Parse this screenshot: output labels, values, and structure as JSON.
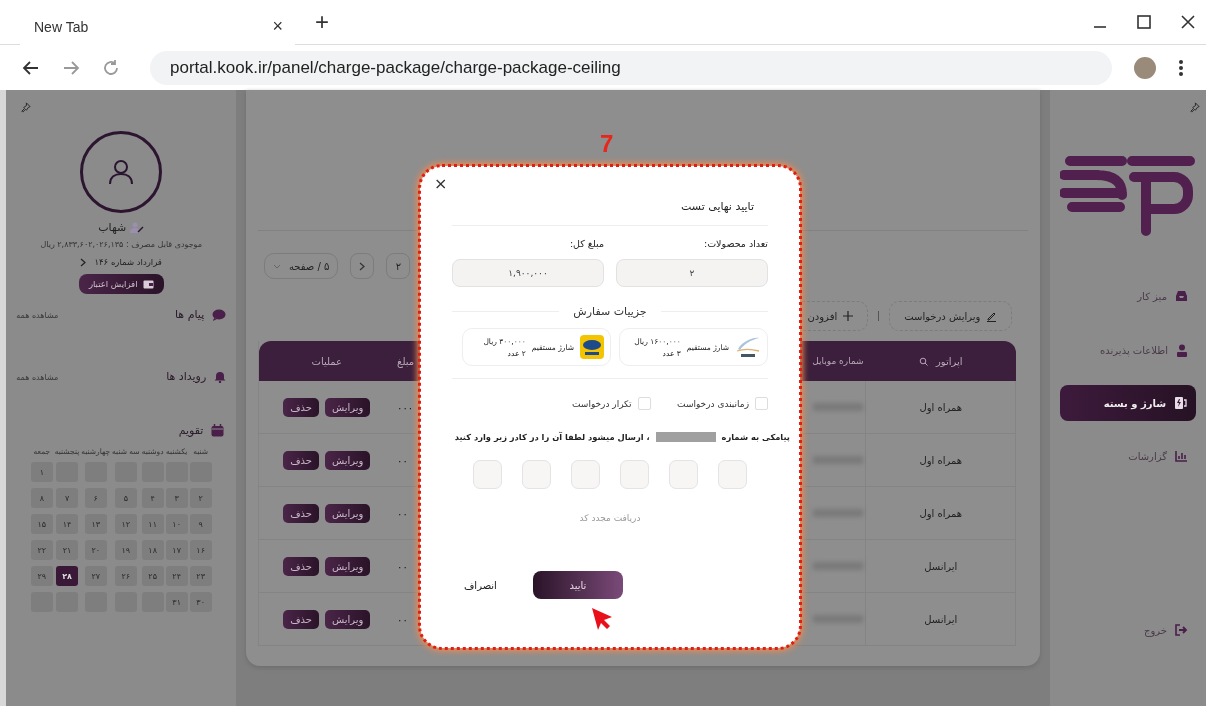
{
  "browser": {
    "tab_title": "New Tab",
    "tab_close": "×",
    "new_tab": "+",
    "url": "portal.kook.ir/panel/charge-package/charge-package-ceiling"
  },
  "left_panel": {
    "user_name": "شهاب",
    "balance": "موجودی قابل مصرف : ۲,۸۳۳,۶۰۲,۰۲۶,۱۳۵ ریال",
    "contract": "قرارداد شماره ۱۴۶",
    "credit_button": "افزایش اعتبار",
    "sections": [
      {
        "kind": "messages",
        "title": "پیام ها",
        "link": "مشاهده همه"
      },
      {
        "kind": "events",
        "title": "رویداد ها",
        "link": "مشاهده همه"
      }
    ],
    "calendar": {
      "title": "تقویم",
      "weekdays": [
        "شنبه",
        "یکشنبه",
        "دوشنبه",
        "سه شنبه",
        "چهارشنبه",
        "پنجشنبه",
        "جمعه"
      ],
      "cells": [
        {
          "kind": "blank"
        },
        {
          "kind": "blank"
        },
        {
          "kind": "blank"
        },
        {
          "kind": "blank"
        },
        {
          "kind": "blank"
        },
        {
          "kind": "blank"
        },
        {
          "kind": "day",
          "day": "۱",
          "selected": false
        },
        {
          "kind": "day",
          "day": "۲",
          "selected": false
        },
        {
          "kind": "day",
          "day": "۳",
          "selected": false
        },
        {
          "kind": "day",
          "day": "۴",
          "selected": false
        },
        {
          "kind": "day",
          "day": "۵",
          "selected": false
        },
        {
          "kind": "day",
          "day": "۶",
          "selected": false
        },
        {
          "kind": "day",
          "day": "۷",
          "selected": false
        },
        {
          "kind": "day",
          "day": "۸",
          "selected": false
        },
        {
          "kind": "day",
          "day": "۹",
          "selected": false
        },
        {
          "kind": "day",
          "day": "۱۰",
          "selected": false
        },
        {
          "kind": "day",
          "day": "۱۱",
          "selected": false
        },
        {
          "kind": "day",
          "day": "۱۲",
          "selected": false
        },
        {
          "kind": "day",
          "day": "۱۳",
          "selected": false
        },
        {
          "kind": "day",
          "day": "۱۴",
          "selected": false
        },
        {
          "kind": "day",
          "day": "۱۵",
          "selected": false
        },
        {
          "kind": "day",
          "day": "۱۶",
          "selected": false
        },
        {
          "kind": "day",
          "day": "۱۷",
          "selected": false
        },
        {
          "kind": "day",
          "day": "۱۸",
          "selected": false
        },
        {
          "kind": "day",
          "day": "۱۹",
          "selected": false
        },
        {
          "kind": "day",
          "day": "۲۰",
          "selected": false
        },
        {
          "kind": "day",
          "day": "۲۱",
          "selected": false
        },
        {
          "kind": "day",
          "day": "۲۲",
          "selected": false
        },
        {
          "kind": "day",
          "day": "۲۳",
          "selected": false
        },
        {
          "kind": "day",
          "day": "۲۴",
          "selected": false
        },
        {
          "kind": "day",
          "day": "۲۵",
          "selected": false
        },
        {
          "kind": "day",
          "day": "۲۶",
          "selected": false
        },
        {
          "kind": "day",
          "day": "۲۷",
          "selected": false
        },
        {
          "kind": "day",
          "day": "۲۸",
          "selected": true
        },
        {
          "kind": "day",
          "day": "۲۹",
          "selected": false
        },
        {
          "kind": "day",
          "day": "۳۰",
          "selected": false
        },
        {
          "kind": "day",
          "day": "۳۱",
          "selected": false
        },
        {
          "kind": "blank"
        },
        {
          "kind": "blank"
        },
        {
          "kind": "blank"
        },
        {
          "kind": "blank"
        },
        {
          "kind": "blank"
        }
      ]
    }
  },
  "main": {
    "page_size": "۵ / صفحه",
    "pages": [
      {
        "label": "۲",
        "selected": false
      }
    ],
    "toolbar": [
      {
        "kind": "edit",
        "label": "ویرایش درخواست"
      },
      {
        "kind": "add",
        "label": "افزودن"
      }
    ],
    "table": {
      "columns": [
        {
          "label": "اپراتور",
          "searchable": true
        },
        {
          "label": "شماره موبایل",
          "searchable": false
        },
        {
          "label": "مبلغ",
          "searchable": false
        },
        {
          "label": "عملیات",
          "searchable": false
        }
      ],
      "rows": [
        {
          "operator": "همراه اول",
          "amount": "۰۰۰",
          "actions": [
            "ویرایش",
            "حذف"
          ]
        },
        {
          "operator": "همراه اول",
          "amount": "۰۰",
          "actions": [
            "ویرایش",
            "حذف"
          ]
        },
        {
          "operator": "همراه اول",
          "amount": "۰۰",
          "actions": [
            "ویرایش",
            "حذف"
          ]
        },
        {
          "operator": "ایرانسل",
          "amount": "۰۰",
          "actions": [
            "ویرایش",
            "حذف"
          ]
        },
        {
          "operator": "ایرانسل",
          "amount": "۰۰",
          "actions": [
            "ویرایش",
            "حذف"
          ]
        }
      ]
    }
  },
  "right_sidebar": {
    "nav": [
      {
        "kind": "desk",
        "label": "میز کار",
        "selected": false
      },
      {
        "kind": "info",
        "label": "اطلاعات پذیرنده",
        "selected": false
      },
      {
        "kind": "charge",
        "label": "شارژ و بسته",
        "selected": true
      },
      {
        "kind": "reports",
        "label": "گزارشات",
        "selected": false
      }
    ],
    "logout": "خروج"
  },
  "modal": {
    "annotation": "7",
    "title": "تایید نهایی تست",
    "close": "×",
    "fields": [
      {
        "label": "تعداد محصولات:",
        "value": "۲"
      },
      {
        "label": "مبلغ کل:",
        "value": "۱,۹۰۰,۰۰۰"
      }
    ],
    "details_title": "جزییات سفارش",
    "orders": [
      {
        "kind": "mci",
        "name": "شارژ مستقیم",
        "price": "۱۶۰۰,۰۰۰ ریال",
        "count": "۳ عدد"
      },
      {
        "kind": "mtn",
        "name": "شارژ مستقیم",
        "price": "۳۰۰,۰۰۰ ریال",
        "count": "۲ عدد"
      }
    ],
    "options": [
      {
        "label": "زمانبندی درخواست",
        "checked": false
      },
      {
        "label": "تکرار درخواست",
        "checked": false
      }
    ],
    "sms_before": "پیامکی به شماره",
    "sms_after": "، ارسال میشود لطفا آن را در کادر زیر وارد کنید",
    "resend": "دریافت مجدد کد",
    "confirm": "تایید",
    "cancel": "انصراف"
  }
}
